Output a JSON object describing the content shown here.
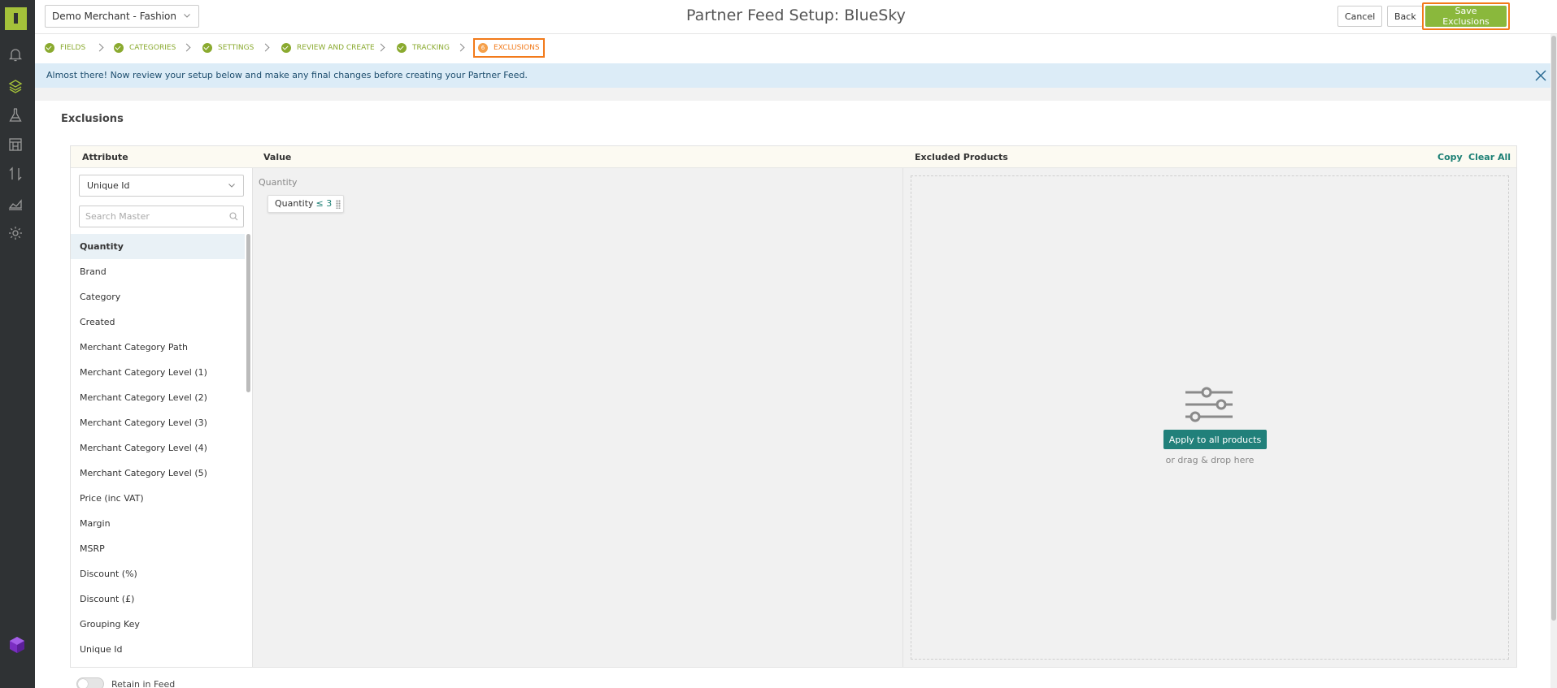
{
  "topbar": {
    "merchant": "Demo Merchant - Fashion",
    "title": "Partner Feed Setup: BlueSky",
    "cancel_label": "Cancel",
    "back_label": "Back",
    "save_label": "Save Exclusions"
  },
  "steps": [
    {
      "label": "FIELDS",
      "status": "done"
    },
    {
      "label": "CATEGORIES",
      "status": "done"
    },
    {
      "label": "SETTINGS",
      "status": "done"
    },
    {
      "label": "REVIEW AND CREATE",
      "status": "done"
    },
    {
      "label": "TRACKING",
      "status": "done"
    },
    {
      "label": "EXCLUSIONS",
      "status": "active",
      "number": "6"
    }
  ],
  "banner": {
    "text": "Almost there! Now review your setup below and make any final changes before creating your Partner Feed."
  },
  "section": {
    "title": "Exclusions"
  },
  "table": {
    "col_attribute": "Attribute",
    "col_value": "Value",
    "col_excluded": "Excluded Products",
    "copy_label": "Copy",
    "clear_label": "Clear All"
  },
  "attribute": {
    "selected_field": "Unique Id",
    "search_placeholder": "Search Master",
    "items": [
      "Quantity",
      "Brand",
      "Category",
      "Created",
      "Merchant Category Path",
      "Merchant Category Level (1)",
      "Merchant Category Level (2)",
      "Merchant Category Level (3)",
      "Merchant Category Level (4)",
      "Merchant Category Level (5)",
      "Price (inc VAT)",
      "Margin",
      "MSRP",
      "Discount (%)",
      "Discount (£)",
      "Grouping Key",
      "Unique Id"
    ]
  },
  "value": {
    "label": "Quantity",
    "chip_field": "Quantity",
    "chip_op": "≤ 3"
  },
  "excluded": {
    "apply_label": "Apply to all products",
    "hint": "or drag & drop here"
  },
  "retain": {
    "label": "Retain in Feed"
  },
  "colors": {
    "brand_green": "#8ab83c",
    "accent_orange": "#f27a1a",
    "teal": "#21807a",
    "rail": "#2f3234"
  }
}
